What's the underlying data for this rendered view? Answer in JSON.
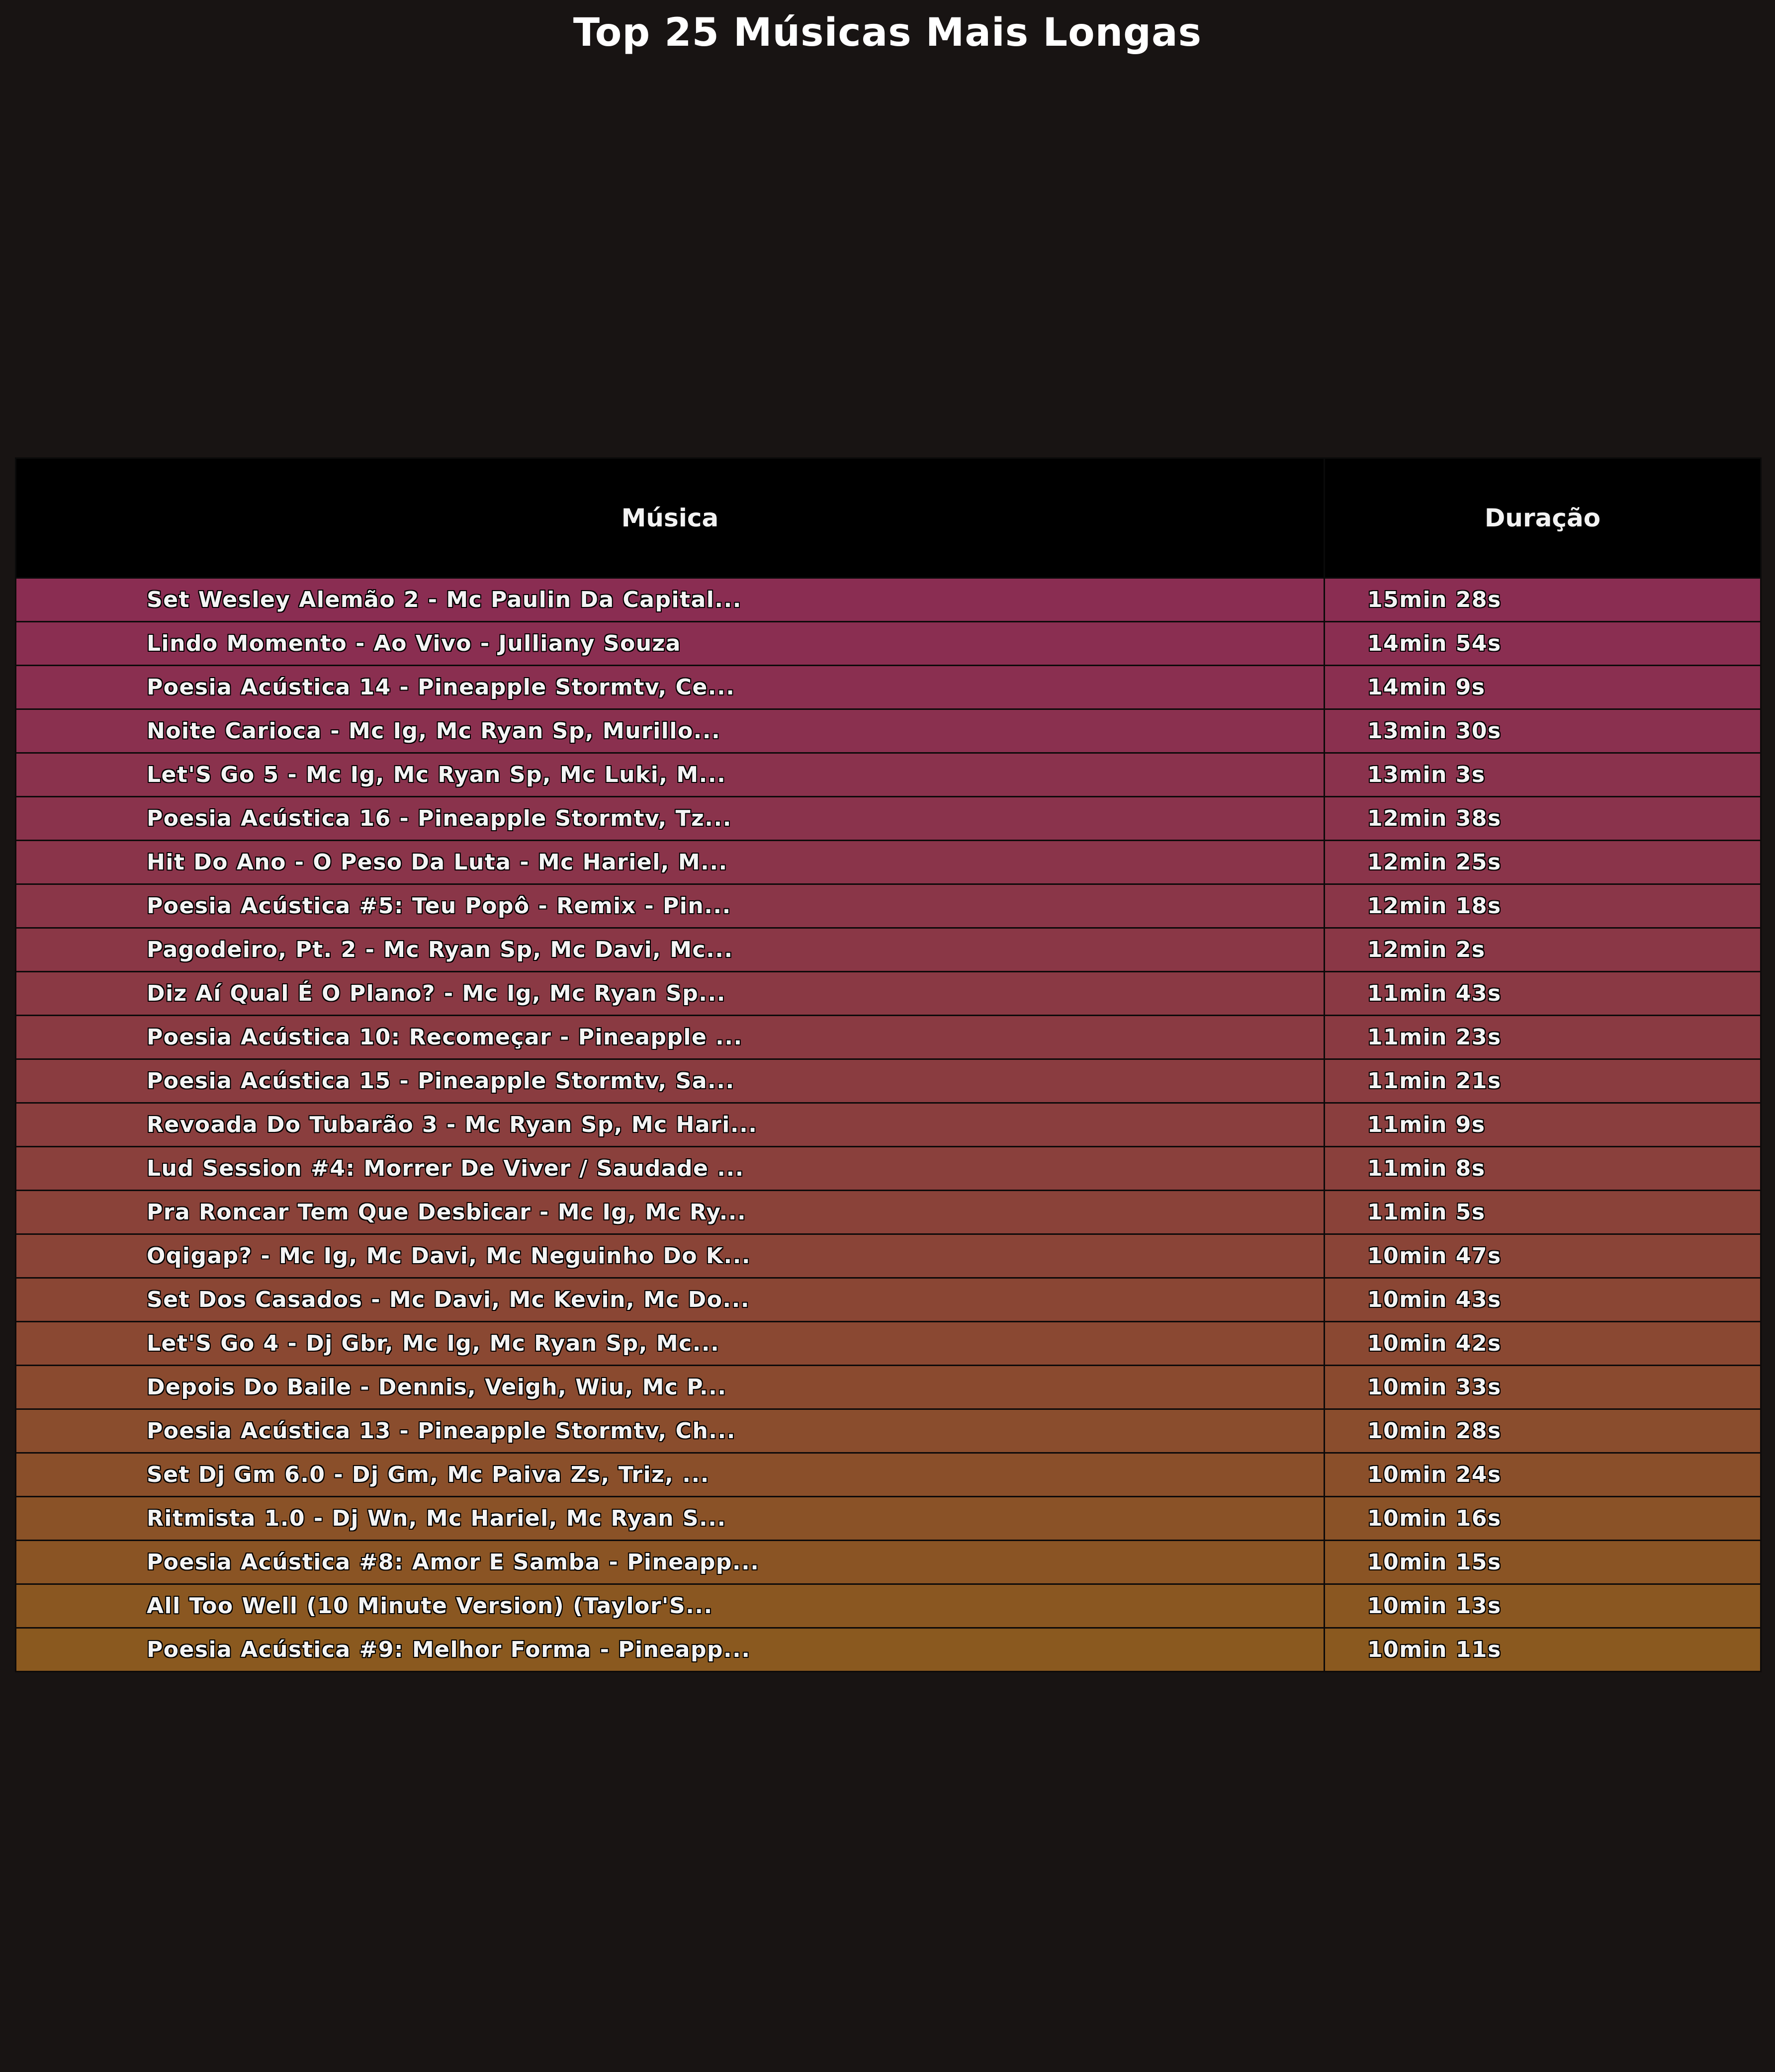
{
  "chart_data": {
    "type": "table",
    "title": "Top 25 Músicas Mais Longas",
    "columns": [
      "Música",
      "Duração"
    ],
    "rows": [
      {
        "music": "Set Wesley Alemão 2 - Mc Paulin Da Capital...",
        "duration": "15min 28s",
        "color": "#8a2d52"
      },
      {
        "music": "Lindo Momento - Ao Vivo - Julliany Souza",
        "duration": "14min 54s",
        "color": "#8a2e51"
      },
      {
        "music": "Poesia Acústica 14 - Pineapple Stormtv, Ce...",
        "duration": "14min 9s",
        "color": "#8a2f50"
      },
      {
        "music": "Noite Carioca - Mc Ig, Mc Ryan Sp, Murillo...",
        "duration": "13min 30s",
        "color": "#8a304f"
      },
      {
        "music": "Let'S Go 5 - Mc Ig, Mc Ryan Sp, Mc Luki, M...",
        "duration": "13min 3s",
        "color": "#8a324d"
      },
      {
        "music": "Poesia Acústica 16 - Pineapple Stormtv, Tz...",
        "duration": "12min 38s",
        "color": "#8a334c"
      },
      {
        "music": "Hit Do Ano - O Peso Da Luta - Mc Hariel, M...",
        "duration": "12min 25s",
        "color": "#8a344a"
      },
      {
        "music": "Poesia Acústica #5: Teu Popô - Remix - Pin...",
        "duration": "12min 18s",
        "color": "#8a3648"
      },
      {
        "music": "Pagodeiro, Pt. 2 - Mc Ryan Sp, Mc Davi, Mc...",
        "duration": "12min 2s",
        "color": "#8a3746"
      },
      {
        "music": "Diz Aí Qual É O Plano? - Mc Ig, Mc Ryan Sp...",
        "duration": "11min 43s",
        "color": "#8a3944"
      },
      {
        "music": "Poesia Acústica 10: Recomeçar - Pineapple ...",
        "duration": "11min 23s",
        "color": "#8a3a42"
      },
      {
        "music": "Poesia Acústica 15 - Pineapple Stormtv, Sa...",
        "duration": "11min 21s",
        "color": "#8a3c40"
      },
      {
        "music": "Revoada Do Tubarão 3 - Mc Ryan Sp, Mc Hari...",
        "duration": "11min 9s",
        "color": "#8a3e3e"
      },
      {
        "music": "Lud Session #4: Morrer De Viver / Saudade ...",
        "duration": "11min 8s",
        "color": "#8a403c"
      },
      {
        "music": "Pra Roncar Tem Que Desbicar - Mc Ig, Mc Ry...",
        "duration": "11min 5s",
        "color": "#8a4239"
      },
      {
        "music": "Oqigap? - Mc Ig, Mc Davi, Mc Neguinho Do K...",
        "duration": "10min 47s",
        "color": "#8a4437"
      },
      {
        "music": "Set Dos Casados - Mc Davi, Mc Kevin, Mc Do...",
        "duration": "10min 43s",
        "color": "#8a4634"
      },
      {
        "music": "Let'S Go 4 - Dj Gbr, Mc Ig, Mc Ryan Sp, Mc...",
        "duration": "10min 42s",
        "color": "#8a4832"
      },
      {
        "music": "Depois Do Baile - Dennis, Veigh, Wiu, Mc P...",
        "duration": "10min 33s",
        "color": "#8a4a2f"
      },
      {
        "music": "Poesia Acústica 13 - Pineapple Stormtv, Ch...",
        "duration": "10min 28s",
        "color": "#8a4d2d"
      },
      {
        "music": "Set Dj Gm 6.0 - Dj Gm, Mc Paiva Zs, Triz, ...",
        "duration": "10min 24s",
        "color": "#8a4f2a"
      },
      {
        "music": "Ritmista 1.0 - Dj Wn, Mc Hariel, Mc Ryan S...",
        "duration": "10min 16s",
        "color": "#8a5227"
      },
      {
        "music": "Poesia Acústica #8: Amor E Samba - Pineapp...",
        "duration": "10min 15s",
        "color": "#8a5424"
      },
      {
        "music": "All Too Well (10 Minute Version) (Taylor'S...",
        "duration": "10min 13s",
        "color": "#8a5721"
      },
      {
        "music": "Poesia Acústica #9: Melhor Forma - Pineapp...",
        "duration": "10min 11s",
        "color": "#8a591f"
      }
    ]
  }
}
